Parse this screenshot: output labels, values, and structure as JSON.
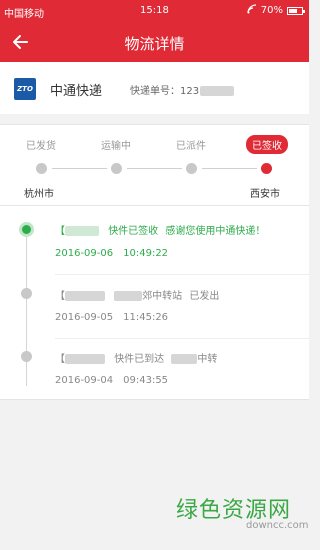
{
  "status_bar": {
    "carrier": "中国移动",
    "time": "15:18",
    "battery": "70%",
    "battery_level": 0.7
  },
  "app_bar": {
    "title": "物流详情"
  },
  "carrier": {
    "logo_text": "ZTO",
    "name": "中通快递",
    "tracking_label": "快递单号：123"
  },
  "progress": {
    "steps": [
      "已发货",
      "运输中",
      "已派件",
      "已签收"
    ],
    "active_step": 3,
    "origin": "杭州市",
    "destination": "西安市"
  },
  "events": [
    {
      "bracket": "【",
      "status": "快件已签收",
      "message": "感谢您使用中通快递！",
      "date": "2016-09-06",
      "time": "10:49:22",
      "active": true
    },
    {
      "bracket": "【",
      "status": "郊中转站",
      "message": "已发出",
      "date": "2016-09-05",
      "time": "11:45:26",
      "active": false
    },
    {
      "bracket": "【",
      "status": "快件已到达",
      "message": "中转",
      "date": "2016-09-04",
      "time": "09:43:55",
      "active": false
    }
  ],
  "watermark": {
    "text": "绿色资源网",
    "url": "downcc.com"
  },
  "colors": {
    "brand_red": "#e02a36",
    "active_green": "#2eac4c"
  }
}
